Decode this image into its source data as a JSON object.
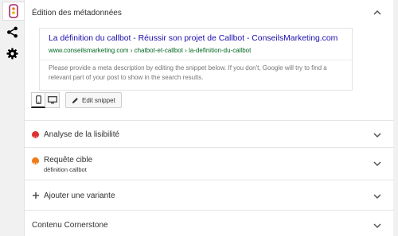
{
  "rail": {
    "items": [
      {
        "icon": "traffic-light-icon"
      },
      {
        "icon": "share-icon"
      },
      {
        "icon": "gear-icon"
      }
    ]
  },
  "metadescription": {
    "title": "Édition des métadonnées",
    "snippet": {
      "title": "La définition du callbot - Réussir son projet de Callbot - ConseilsMarketing.com",
      "url": "www.conseilsmarketing.com › chatbot-et-callbot › la-definition-du-callbot",
      "description": "Please provide a meta description by editing the snippet below. If you don't, Google will try to find a relevant part of your post to show in the search results."
    },
    "mode": "mobile",
    "edit_snippet_label": "Edit snippet"
  },
  "sections": {
    "readability": {
      "title": "Analyse de la lisibilité",
      "status_color": "#dc3232"
    },
    "keyphrase": {
      "title": "Requête cible",
      "value": "définition callbot",
      "status_color": "#ee7c1b"
    },
    "add_variant": {
      "title": "Ajouter une variante"
    },
    "cornerstone": {
      "title": "Contenu Cornerstone"
    }
  },
  "colors": {
    "link": "#1a0dab",
    "url": "#006621",
    "icon_purple": "#a4286a"
  }
}
